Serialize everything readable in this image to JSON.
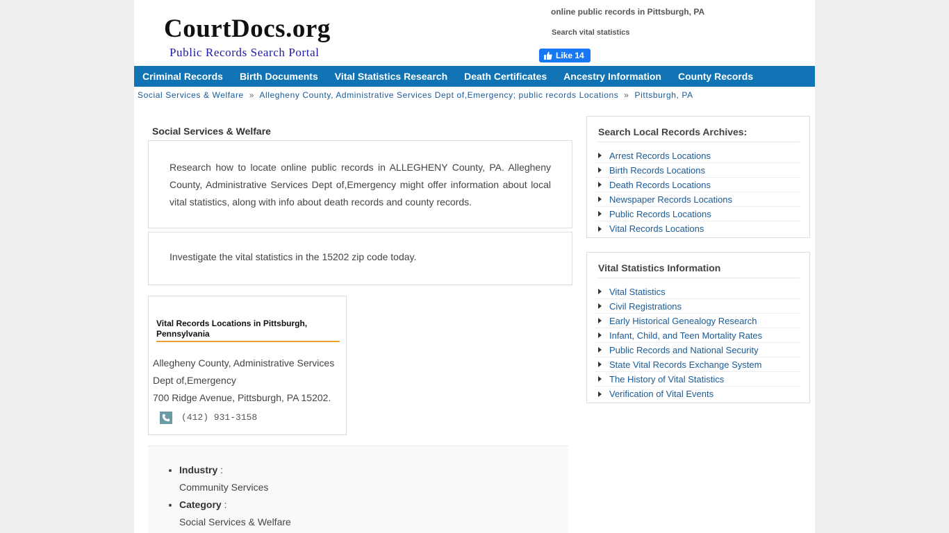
{
  "header": {
    "logo_title": "CourtDocs.org",
    "logo_subtitle": "Public Records Search Portal",
    "link_primary": "online public records in Pittsburgh, PA",
    "link_secondary": "Search vital statistics",
    "fb_like_label": "Like 14"
  },
  "nav": {
    "items": [
      {
        "label": "Criminal Records"
      },
      {
        "label": "Birth Documents"
      },
      {
        "label": "Vital Statistics Research"
      },
      {
        "label": "Death Certificates"
      },
      {
        "label": "Ancestry Information"
      },
      {
        "label": "County Records"
      }
    ]
  },
  "breadcrumb": {
    "items": [
      {
        "label": "Social Services & Welfare"
      },
      {
        "label": "Allegheny County, Administrative Services Dept of,Emergency; public records Locations"
      },
      {
        "label": "Pittsburgh, PA"
      }
    ],
    "separator": "»"
  },
  "main": {
    "section_title": "Social Services & Welfare",
    "intro_text": "Research how to locate online public records in ALLEGHENY County, PA. Allegheny County, Administrative Services Dept of,Emergency might offer information about local vital statistics, along with info about death records and county records.",
    "zip_text": "Investigate the vital statistics in the 15202 zip code today.",
    "card": {
      "title": "Vital Records Locations in Pittsburgh, Pennsylvania",
      "name_line1": "Allegheny County, Administrative Services",
      "name_line2": "Dept of,Emergency",
      "address": "700 Ridge Avenue, Pittsburgh, PA 15202.",
      "phone": "(412) 931-3158"
    },
    "details": [
      {
        "label": "Industry",
        "value": "Community Services"
      },
      {
        "label": "Category",
        "value": "Social Services & Welfare"
      }
    ]
  },
  "sidebar": {
    "archives": {
      "title": "Search Local Records Archives:",
      "items": [
        {
          "label": "Arrest Records Locations"
        },
        {
          "label": "Birth Records Locations"
        },
        {
          "label": "Death Records Locations"
        },
        {
          "label": "Newspaper Records Locations"
        },
        {
          "label": "Public Records Locations"
        },
        {
          "label": "Vital Records Locations"
        }
      ]
    },
    "vital": {
      "title": "Vital Statistics Information",
      "items": [
        {
          "label": "Vital Statistics"
        },
        {
          "label": "Civil Registrations"
        },
        {
          "label": "Early Historical Genealogy Research"
        },
        {
          "label": "Infant, Child, and Teen Mortality Rates"
        },
        {
          "label": "Public Records and National Security"
        },
        {
          "label": "State Vital Records Exchange System"
        },
        {
          "label": "The History of Vital Statistics"
        },
        {
          "label": "Verification of Vital Events"
        }
      ]
    }
  },
  "colors": {
    "nav_bg": "#0f73b4",
    "link": "#1a5a96",
    "accent_underline": "#f0a030",
    "fb_blue": "#1877f2"
  }
}
